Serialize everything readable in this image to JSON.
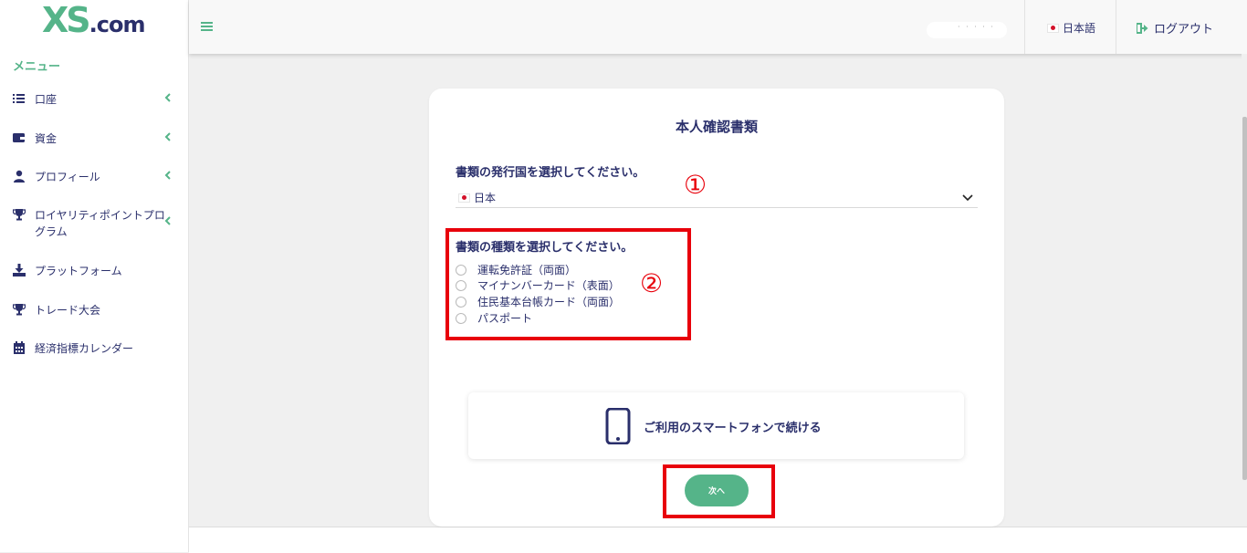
{
  "brand": {
    "logo_main": "XS",
    "logo_suffix": ".com"
  },
  "sidebar": {
    "heading": "メニュー",
    "items": [
      {
        "label": "口座",
        "icon": "list-icon",
        "has_chevron": true
      },
      {
        "label": "資金",
        "icon": "wallet-icon",
        "has_chevron": true
      },
      {
        "label": "プロフィール",
        "icon": "user-icon",
        "has_chevron": true
      },
      {
        "label": "ロイヤリティポイントプログラム",
        "icon": "trophy-icon",
        "has_chevron": true
      },
      {
        "label": "プラットフォーム",
        "icon": "download-icon",
        "has_chevron": false
      },
      {
        "label": "トレード大会",
        "icon": "trophy-icon",
        "has_chevron": false
      },
      {
        "label": "経済指標カレンダー",
        "icon": "calendar-icon",
        "has_chevron": false
      }
    ]
  },
  "topbar": {
    "user_name": "· · · · ·",
    "language_label": "日本語",
    "logout_label": "ログアウト"
  },
  "card": {
    "title": "本人確認書類",
    "country_label": "書類の発行国を選択してください。",
    "country_value": "日本",
    "doc_type_label": "書類の種類を選択してください。",
    "doc_options": [
      "運転免許証（両面）",
      "マイナンバーカード（表面）",
      "住民基本台帳カード（両面）",
      "パスポート"
    ],
    "smartphone_label": "ご利用のスマートフォンで続ける",
    "next_label": "次へ"
  },
  "annotations": {
    "step1": "①",
    "step2": "②"
  },
  "colors": {
    "accent_green": "#55b489",
    "navy": "#2a2f6b",
    "annotation_red": "#e8000b"
  }
}
